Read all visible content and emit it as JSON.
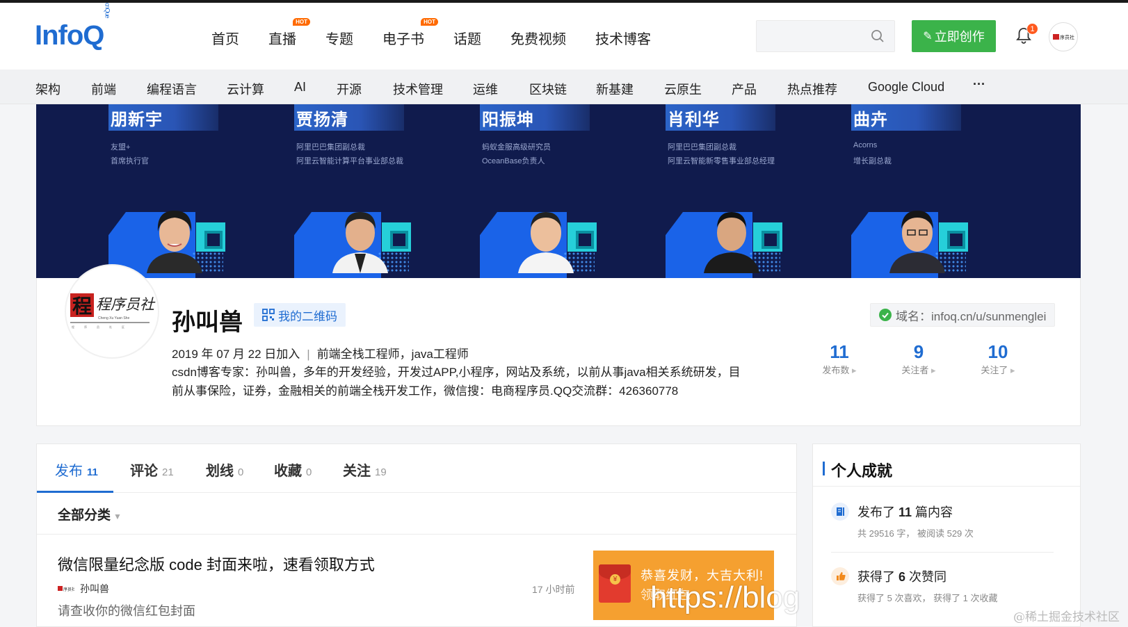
{
  "header": {
    "logo": "InfoQ",
    "logo_sub": "cnQue",
    "nav": [
      {
        "label": "首页",
        "hot": ""
      },
      {
        "label": "直播",
        "hot": "HOT"
      },
      {
        "label": "专题",
        "hot": ""
      },
      {
        "label": "电子书",
        "hot": "HOT"
      },
      {
        "label": "话题",
        "hot": ""
      },
      {
        "label": "免费视频",
        "hot": ""
      },
      {
        "label": "技术博客",
        "hot": ""
      }
    ],
    "search_placeholder": "",
    "create_label": "立即创作",
    "notification_count": "1"
  },
  "categories": [
    "架构",
    "前端",
    "编程语言",
    "云计算",
    "AI",
    "开源",
    "技术管理",
    "运维",
    "区块链",
    "新基建",
    "云原生",
    "产品",
    "热点推荐",
    "Google Cloud",
    "···"
  ],
  "banner": {
    "speakers": [
      {
        "name": "朋新宇",
        "line1": "友盟+",
        "line2": "首席执行官"
      },
      {
        "name": "贾扬清",
        "line1": "阿里巴巴集团副总裁",
        "line2": "阿里云智能计算平台事业部总裁"
      },
      {
        "name": "阳振坤",
        "line1": "蚂蚁金服高级研究员",
        "line2": "OceanBase负责人"
      },
      {
        "name": "肖利华",
        "line1": "阿里巴巴集团副总裁",
        "line2": "阿里云智能新零售事业部总经理"
      },
      {
        "name": "曲卉",
        "line1": "Acorns",
        "line2": "增长副总裁"
      }
    ]
  },
  "profile": {
    "name": "孙叫兽",
    "qr_label": "我的二维码",
    "joined": "2019 年 07 月 22 日加入",
    "title": "前端全栈工程师，java工程师",
    "bio": "csdn博客专家：孙叫兽，多年的开发经验，开发过APP,小程序，网站及系统，以前从事java相关系统研发，目前从事保险，证券，金融相关的前端全栈开发工作，微信搜：电商程序员.QQ交流群：426360778",
    "domain": "域名：infoq.cn/u/sunmenglei",
    "avatar_text": "程序员社",
    "avatar_sub": "Cheng Xu Yuan She",
    "stats": [
      {
        "num": "11",
        "label": "发布数"
      },
      {
        "num": "9",
        "label": "关注者"
      },
      {
        "num": "10",
        "label": "关注了"
      }
    ]
  },
  "tabs": [
    {
      "label": "发布",
      "count": "11"
    },
    {
      "label": "评论",
      "count": "21"
    },
    {
      "label": "划线",
      "count": "0"
    },
    {
      "label": "收藏",
      "count": "0"
    },
    {
      "label": "关注",
      "count": "19"
    }
  ],
  "filter_label": "全部分类",
  "article": {
    "title": "微信限量纪念版 code 封面来啦，速看领取方式",
    "author": "孙叫兽",
    "time": "17 小时前",
    "summary": "请查收你的微信红包封面",
    "thumb_line1": "恭喜发财，大吉大利!",
    "thumb_line2": "领取红包",
    "overlay_url": "https://blog"
  },
  "achievements": {
    "title": "个人成就",
    "items": [
      {
        "prefix": "发布了 ",
        "value": "11",
        "suffix": " 篇内容",
        "sub": "共 29516 字， 被阅读 529 次"
      },
      {
        "prefix": "获得了 ",
        "value": "6",
        "suffix": " 次赞同",
        "sub": "获得了 5 次喜欢， 获得了 1 次收藏"
      }
    ]
  },
  "watermark": "@稀土掘金技术社区",
  "colors": {
    "brand": "#1f6cd1",
    "create": "#3bb34a",
    "hot": "#ff6a00",
    "banner": "#101b4d"
  }
}
